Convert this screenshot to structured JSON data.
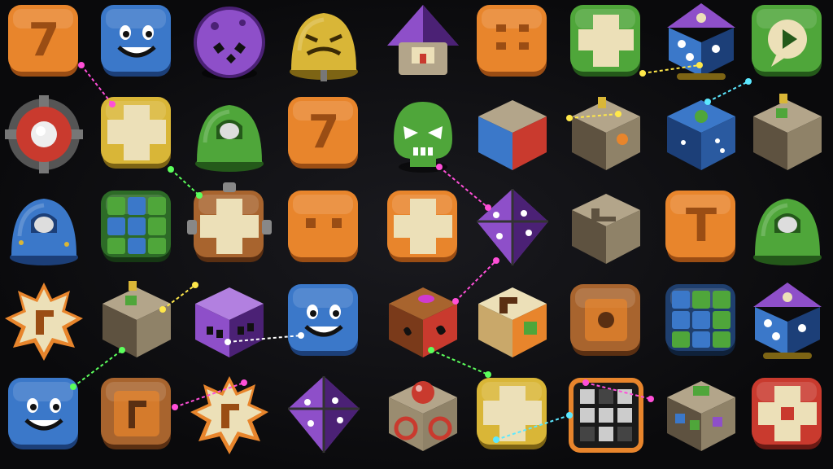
{
  "palette": {
    "orange": "#e8852c",
    "orange_dark": "#9a4d14",
    "blue": "#3b78c9",
    "blue_dark": "#1c3f78",
    "green": "#4fa63a",
    "green_dark": "#24591a",
    "purple": "#8e4fc9",
    "purple_dark": "#4b2175",
    "yellow": "#d9b637",
    "yellow_dark": "#7d6414",
    "stone": "#b3a58a",
    "stone_dark": "#5e5240",
    "wood": "#a8642e",
    "wood_dark": "#5a2f12",
    "red": "#c93a2e",
    "cream": "#ece0b8",
    "magenta_spark": "#ff4fd8",
    "green_spark": "#5cff5c",
    "yellow_spark": "#ffe84a",
    "cyan_spark": "#5ce8ff",
    "white_spark": "#ffffff"
  },
  "board": {
    "rows": [
      [
        {
          "kind": "orange-seven-block",
          "glyph": "7"
        },
        {
          "kind": "blue-smiley-block"
        },
        {
          "kind": "purple-ball-monster"
        },
        {
          "kind": "yellow-dome-grumpy"
        },
        {
          "kind": "purple-roof-pyramid"
        },
        {
          "kind": "orange-hash-block",
          "glyph": "⁑"
        },
        {
          "kind": "green-quad-block"
        },
        {
          "kind": "purple-dice-house"
        },
        {
          "kind": "green-speech-bubble-block"
        }
      ],
      [
        {
          "kind": "red-gear-ring"
        },
        {
          "kind": "yellow-cross-block"
        },
        {
          "kind": "green-dome-bell"
        },
        {
          "kind": "orange-seven-block",
          "glyph": "7"
        },
        {
          "kind": "green-skull-monster"
        },
        {
          "kind": "blue-red-split-cube"
        },
        {
          "kind": "stone-switch-box"
        },
        {
          "kind": "blue-dotted-cube"
        },
        {
          "kind": "stone-button-panel"
        }
      ],
      [
        {
          "kind": "blue-dome-bell"
        },
        {
          "kind": "green-blue-grid-block"
        },
        {
          "kind": "wood-cross-gear"
        },
        {
          "kind": "orange-eyes-block"
        },
        {
          "kind": "orange-cross-block"
        },
        {
          "kind": "purple-diamond-dice"
        },
        {
          "kind": "stone-crate-L"
        },
        {
          "kind": "orange-T-block",
          "glyph": "T"
        },
        {
          "kind": "green-dome-bell"
        }
      ],
      [
        {
          "kind": "orange-gear-star"
        },
        {
          "kind": "stone-button-panel"
        },
        {
          "kind": "purple-face-cube"
        },
        {
          "kind": "blue-smiley-block"
        },
        {
          "kind": "wood-broken-cube"
        },
        {
          "kind": "cream-notch-cube"
        },
        {
          "kind": "wood-carved-block"
        },
        {
          "kind": "blue-green-grid-block"
        },
        {
          "kind": "purple-dice-house"
        }
      ],
      [
        {
          "kind": "blue-smiley-block"
        },
        {
          "kind": "wood-carved-F-block"
        },
        {
          "kind": "orange-gear-star"
        },
        {
          "kind": "purple-diamond-dice"
        },
        {
          "kind": "stone-red-ball-box"
        },
        {
          "kind": "yellow-cross-block"
        },
        {
          "kind": "dark-grid-block"
        },
        {
          "kind": "stone-color-crate"
        },
        {
          "kind": "red-cream-cross-block"
        }
      ]
    ]
  }
}
